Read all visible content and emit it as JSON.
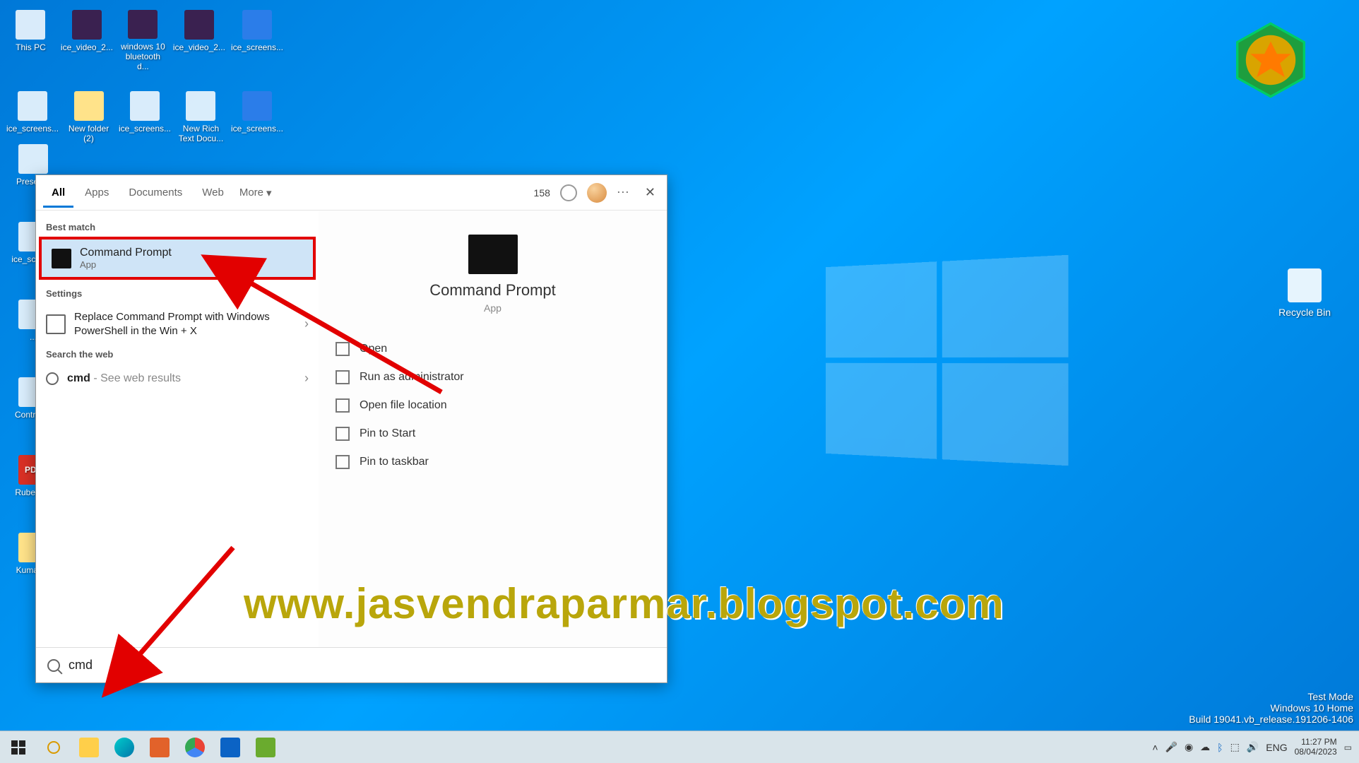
{
  "desktop": {
    "row1": [
      {
        "label": "This PC"
      },
      {
        "label": "ice_video_2..."
      },
      {
        "label": "windows 10 bluetooth d..."
      },
      {
        "label": "ice_video_2..."
      },
      {
        "label": "ice_screens..."
      }
    ],
    "row2": [
      {
        "label": "ice_screens..."
      },
      {
        "label": "New folder (2)"
      },
      {
        "label": "ice_screens..."
      },
      {
        "label": "New Rich Text Docu..."
      },
      {
        "label": "ice_screens..."
      }
    ],
    "leftcol": [
      {
        "label": "Presen..."
      },
      {
        "label": "ice_scree..."
      },
      {
        "label": "..."
      },
      {
        "label": "Control ..."
      },
      {
        "label": "Rubens..."
      },
      {
        "label": "Kumarr..."
      }
    ],
    "recycle": "Recycle Bin"
  },
  "search": {
    "tabs": [
      "All",
      "Apps",
      "Documents",
      "Web"
    ],
    "more": "More",
    "points": "158",
    "close": "✕",
    "best_label": "Best match",
    "best": {
      "title": "Command Prompt",
      "sub": "App"
    },
    "settings_label": "Settings",
    "settings_item": "Replace Command Prompt with Windows PowerShell in the Win + X",
    "web_label": "Search the web",
    "web_item_prefix": "cmd",
    "web_item_suffix": " - See web results",
    "details": {
      "title": "Command Prompt",
      "sub": "App"
    },
    "actions": [
      "Open",
      "Run as administrator",
      "Open file location",
      "Pin to Start",
      "Pin to taskbar"
    ],
    "input_value": "cmd"
  },
  "watermark": "www.jasvendraparmar.blogspot.com",
  "bottom_info": {
    "l1": "Test Mode",
    "l2": "Windows 10 Home",
    "l3": "Build 19041.vb_release.191206-1406"
  },
  "taskbar": {
    "clock_time": "11:27 PM",
    "clock_date": "08/04/2023"
  }
}
